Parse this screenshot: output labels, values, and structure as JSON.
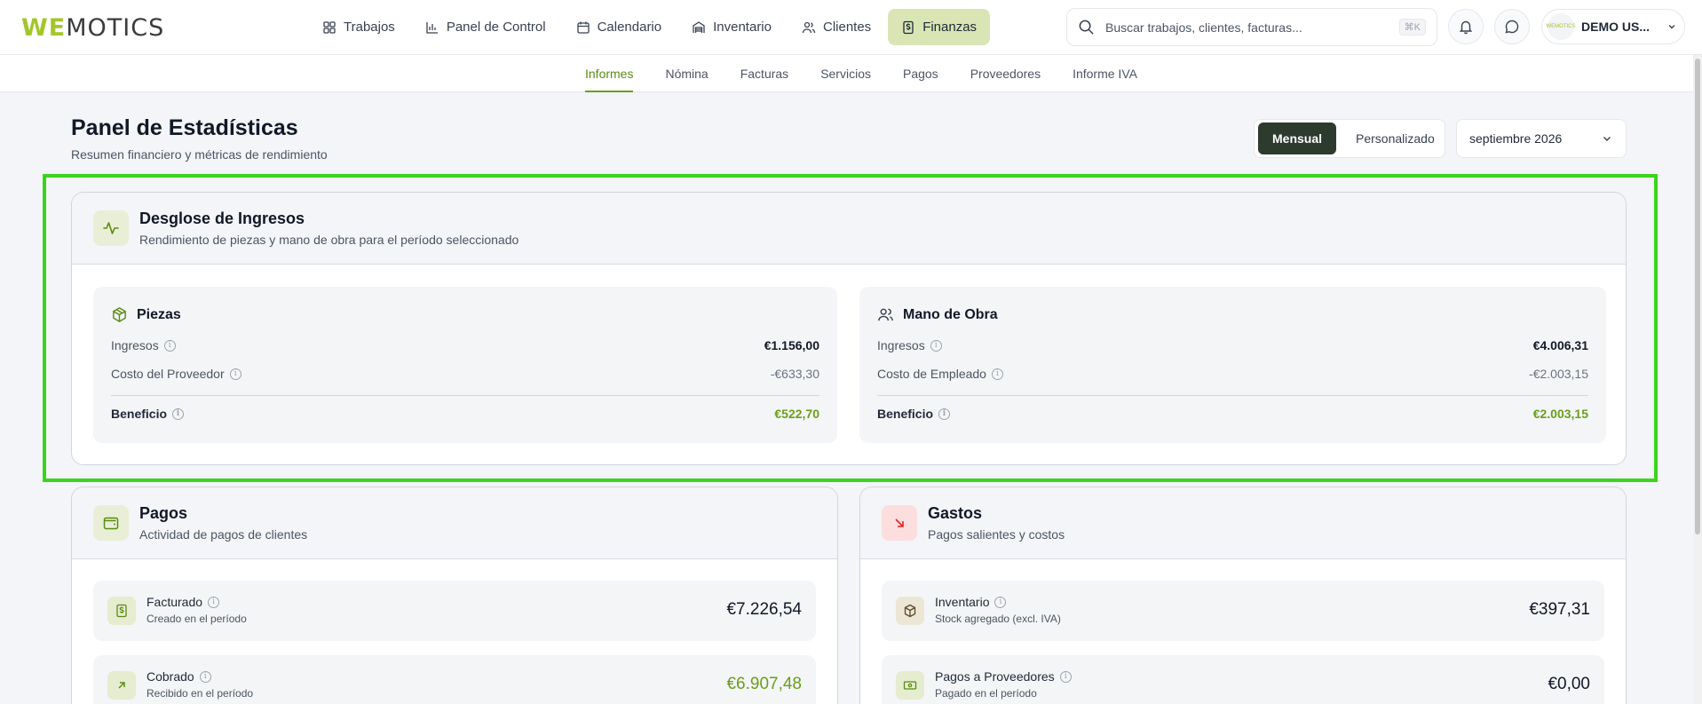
{
  "brand": {
    "logo_part1": "WE",
    "logo_part2": "MOTICS",
    "accent": "#a3c62a"
  },
  "nav": {
    "items": [
      {
        "label": "Trabajos",
        "icon": "grid-icon"
      },
      {
        "label": "Panel de Control",
        "icon": "bar-chart-icon"
      },
      {
        "label": "Calendario",
        "icon": "calendar-icon"
      },
      {
        "label": "Inventario",
        "icon": "warehouse-icon"
      },
      {
        "label": "Clientes",
        "icon": "users-icon"
      },
      {
        "label": "Finanzas",
        "icon": "dollar-icon",
        "active": true
      }
    ]
  },
  "search": {
    "placeholder": "Buscar trabajos, clientes, facturas...",
    "shortcut": "⌘K"
  },
  "user": {
    "name": "DEMO US...",
    "avatar_text": "WEMOTICS"
  },
  "subnav": {
    "tabs": [
      {
        "label": "Informes",
        "active": true
      },
      {
        "label": "Nómina"
      },
      {
        "label": "Facturas"
      },
      {
        "label": "Servicios"
      },
      {
        "label": "Pagos"
      },
      {
        "label": "Proveedores"
      },
      {
        "label": "Informe IVA"
      }
    ]
  },
  "page": {
    "title": "Panel de Estadísticas",
    "subtitle": "Resumen financiero y métricas de rendimiento",
    "toggle_monthly": "Mensual",
    "toggle_custom": "Personalizado",
    "month": "septiembre 2026"
  },
  "income": {
    "title": "Desglose de Ingresos",
    "subtitle": "Rendimiento de piezas y mano de obra para el período seleccionado",
    "parts": {
      "title": "Piezas",
      "revenue_label": "Ingresos",
      "revenue": "€1.156,00",
      "cost_label": "Costo del Proveedor",
      "cost": "-€633,30",
      "profit_label": "Beneficio",
      "profit": "€522,70"
    },
    "labor": {
      "title": "Mano de Obra",
      "revenue_label": "Ingresos",
      "revenue": "€4.006,31",
      "cost_label": "Costo de Empleado",
      "cost": "-€2.003,15",
      "profit_label": "Beneficio",
      "profit": "€2.003,15"
    }
  },
  "payments": {
    "title": "Pagos",
    "subtitle": "Actividad de pagos de clientes",
    "billed": {
      "title": "Facturado",
      "sub": "Creado en el período",
      "value": "€7.226,54"
    },
    "collected": {
      "title": "Cobrado",
      "sub": "Recibido en el período",
      "value": "€6.907,48"
    }
  },
  "expenses": {
    "title": "Gastos",
    "subtitle": "Pagos salientes y costos",
    "inventory": {
      "title": "Inventario",
      "sub": "Stock agregado (excl. IVA)",
      "value": "€397,31"
    },
    "suppliers": {
      "title": "Pagos a Proveedores",
      "sub": "Pagado en el período",
      "value": "€0,00"
    }
  }
}
